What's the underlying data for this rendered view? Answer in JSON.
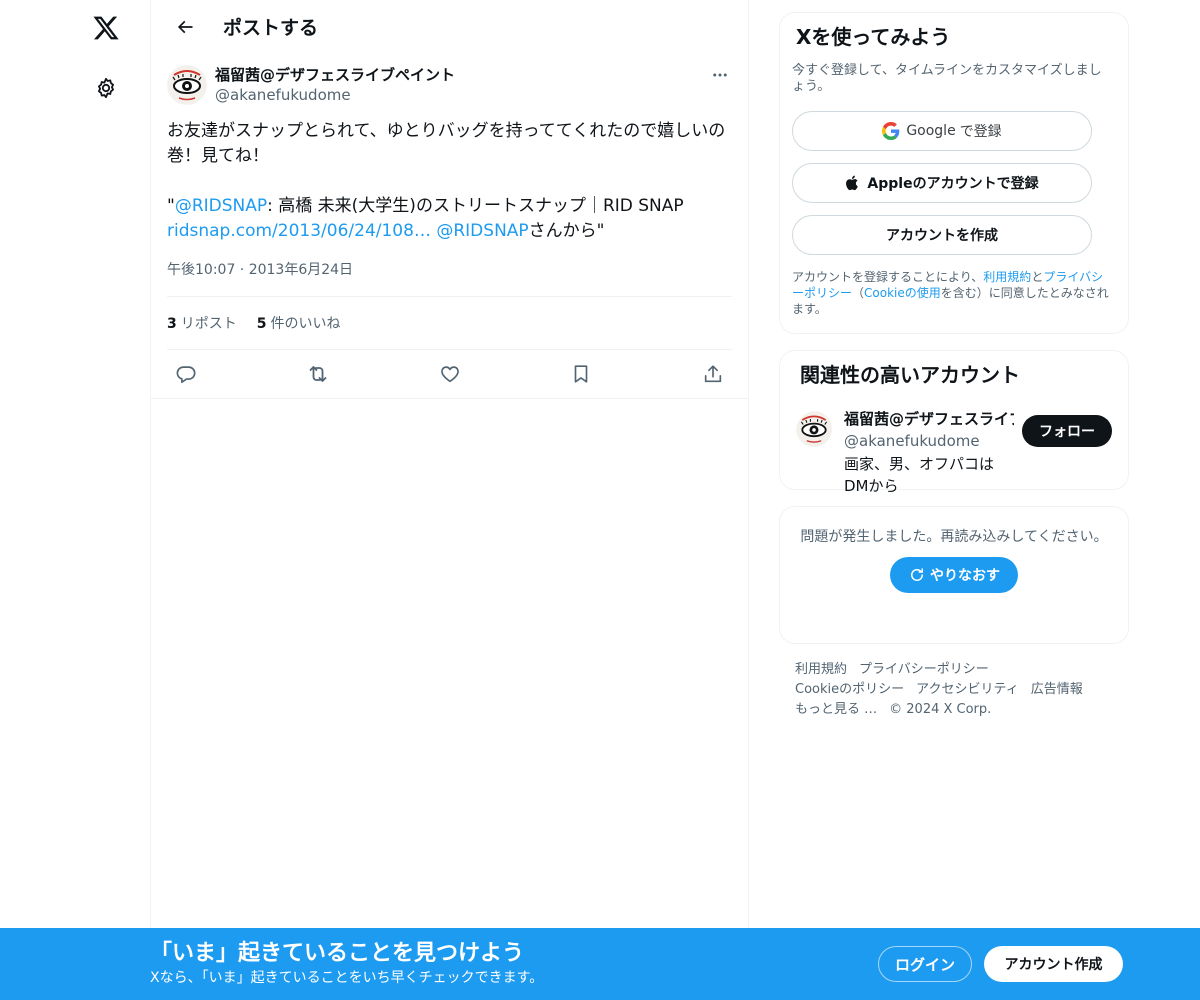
{
  "nav": {
    "logo_icon": "x-logo-icon",
    "settings_icon": "gear-icon"
  },
  "header": {
    "title": "ポストする"
  },
  "post": {
    "author_name": "福留茜@デザフェスライブペイント",
    "author_handle": "@akanefukudome",
    "text_line1": "お友達がスナップとられて、ゆとりバッグを持っててくれたので嬉しいの巻！見てね！",
    "quote_open": "\"",
    "mention1": "@RIDSNAP",
    "text_middle": ": 高橋 未来(大学生)のストリートスナップ｜RID SNAP",
    "link_url": "ridsnap.com/2013/06/24/108…",
    "mention2": "@RIDSNAP",
    "text_end": "さんから\"",
    "time": "午後10:07 · 2013年6月24日",
    "reposts_count": "3",
    "reposts_label": "リポスト",
    "likes_count": "5",
    "likes_label": "件のいいね"
  },
  "signup": {
    "title": "Xを使ってみよう",
    "subtitle": "今すぐ登録して、タイムラインをカスタマイズしましょう。",
    "google_brand": "Google",
    "google_label": "で登録",
    "apple_label": "Appleのアカウントで登録",
    "create_label": "アカウントを作成",
    "terms_pre": "アカウントを登録することにより、",
    "terms_link1": "利用規約",
    "terms_and": "と",
    "terms_link2": "プライバシーポリシー",
    "terms_paren_open": "（",
    "terms_link3": "Cookieの使用",
    "terms_post": "を含む）に同意したとみなされます。"
  },
  "related": {
    "title": "関連性の高いアカウント",
    "name": "福留茜@デザフェスライブペイント",
    "handle": "@akanefukudome",
    "bio": "画家、男、オフパコはDMから",
    "follow_label": "フォロー"
  },
  "error": {
    "message": "問題が発生しました。再読み込みしてください。",
    "retry_label": "やりなおす"
  },
  "footer": {
    "links": [
      "利用規約",
      "プライバシーポリシー",
      "Cookieのポリシー",
      "アクセシビリティ",
      "広告情報",
      "もっと見る …"
    ],
    "copyright": "© 2024 X Corp."
  },
  "bottom_bar": {
    "title": "「いま」起きていることを見つけよう",
    "subtitle": "Xなら、「いま」起きていることをいち早くチェックできます。",
    "login_label": "ログイン",
    "signup_label": "アカウント作成"
  },
  "colors": {
    "accent": "#1d9bf0",
    "text": "#0f1419",
    "muted": "#536471"
  }
}
